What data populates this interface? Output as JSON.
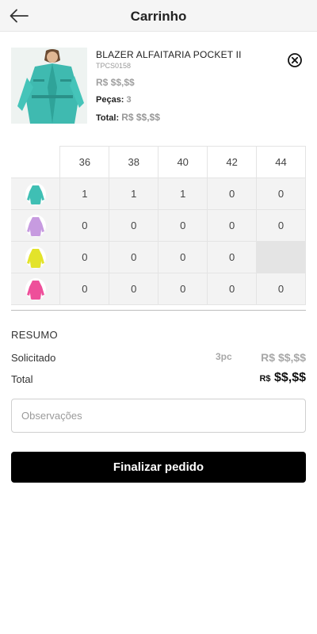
{
  "header": {
    "title": "Carrinho",
    "back_icon": "arrow-left-icon"
  },
  "product": {
    "name": "BLAZER ALFAITARIA POCKET II",
    "sku": "TPCS0158",
    "price": "R$ $$,$$",
    "pieces_label": "Peças:",
    "pieces_value": "3",
    "total_label": "Total:",
    "total_value": "R$ $$,$$",
    "remove_icon": "close-circle-icon"
  },
  "grid": {
    "sizes": [
      "36",
      "38",
      "40",
      "42",
      "44"
    ],
    "rows": [
      {
        "color": "#3fbfb4",
        "quantities": [
          "1",
          "1",
          "1",
          "0",
          "0"
        ]
      },
      {
        "color": "#c79be0",
        "quantities": [
          "0",
          "0",
          "0",
          "0",
          "0"
        ]
      },
      {
        "color": "#e3e32a",
        "quantities": [
          "0",
          "0",
          "0",
          "0",
          ""
        ]
      },
      {
        "color": "#ee4f9a",
        "quantities": [
          "0",
          "0",
          "0",
          "0",
          "0"
        ]
      }
    ]
  },
  "summary": {
    "title": "RESUMO",
    "requested_label": "Solicitado",
    "requested_qty": "3pc",
    "requested_price": "R$ $$,$$",
    "total_label": "Total",
    "total_currency": "R$",
    "total_amount": "$$,$$"
  },
  "observations": {
    "placeholder": "Observações"
  },
  "checkout": {
    "label": "Finalizar pedido"
  }
}
